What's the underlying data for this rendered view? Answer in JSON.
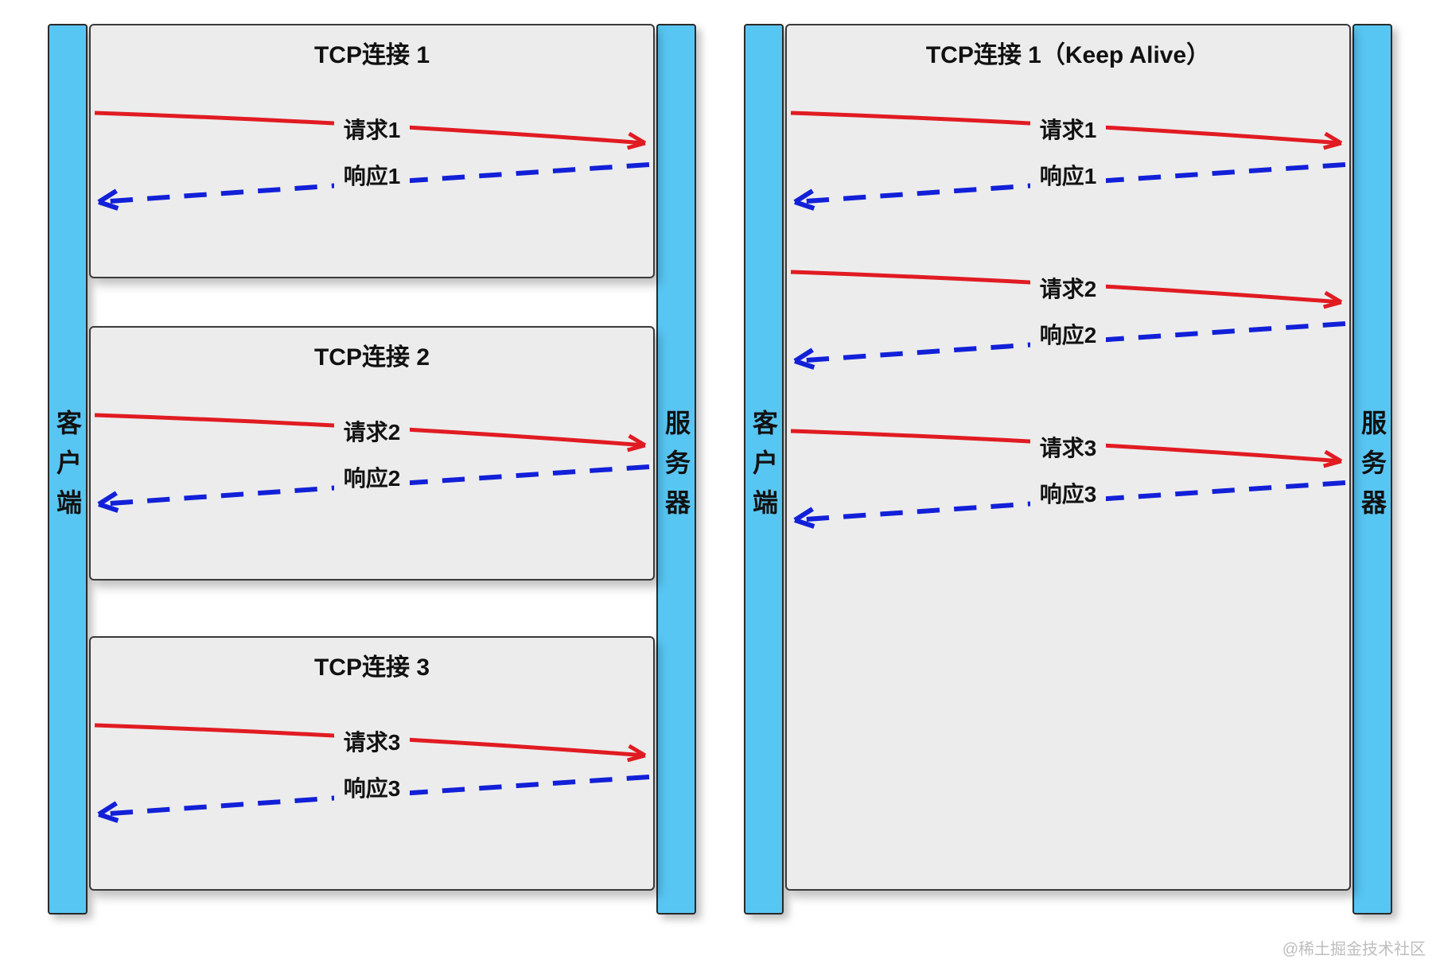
{
  "colors": {
    "request": "#e11b22",
    "response": "#1220d8",
    "bar": "#58c6f2",
    "box": "#ececec"
  },
  "labels": {
    "client": "客户端",
    "server": "服务器"
  },
  "left_panel": {
    "connections": [
      {
        "title": "TCP连接 1",
        "request": "请求1",
        "response": "响应1"
      },
      {
        "title": "TCP连接 2",
        "request": "请求2",
        "response": "响应2"
      },
      {
        "title": "TCP连接 3",
        "request": "请求3",
        "response": "响应3"
      }
    ]
  },
  "right_panel": {
    "title": "TCP连接 1（Keep Alive）",
    "pairs": [
      {
        "request": "请求1",
        "response": "响应1"
      },
      {
        "request": "请求2",
        "response": "响应2"
      },
      {
        "request": "请求3",
        "response": "响应3"
      }
    ]
  },
  "watermark": "@稀土掘金技术社区"
}
